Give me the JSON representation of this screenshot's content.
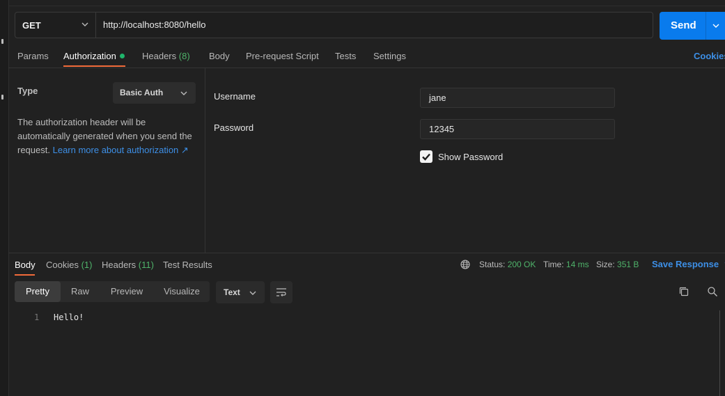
{
  "request": {
    "method": "GET",
    "url": "http://localhost:8080/hello",
    "send_label": "Send"
  },
  "request_tabs": [
    {
      "label": "Params"
    },
    {
      "label": "Authorization"
    },
    {
      "label": "Headers",
      "count": "(8)"
    },
    {
      "label": "Body"
    },
    {
      "label": "Pre-request Script"
    },
    {
      "label": "Tests"
    },
    {
      "label": "Settings"
    }
  ],
  "cookies_link": "Cookies",
  "auth": {
    "type_label": "Type",
    "type_value": "Basic Auth",
    "description": "The authorization header will be automatically generated when you send the request.",
    "learn_more": "Learn more about authorization ↗",
    "username_label": "Username",
    "username_value": "jane",
    "password_label": "Password",
    "password_value": "12345",
    "show_password_label": "Show Password",
    "show_password_checked": true
  },
  "response_tabs": [
    {
      "label": "Body"
    },
    {
      "label": "Cookies",
      "count": "(1)"
    },
    {
      "label": "Headers",
      "count": "(11)"
    },
    {
      "label": "Test Results"
    }
  ],
  "response_meta": {
    "status_label": "Status:",
    "status_value": "200 OK",
    "time_label": "Time:",
    "time_value": "14 ms",
    "size_label": "Size:",
    "size_value": "351 B",
    "save_label": "Save Response"
  },
  "view_modes": [
    "Pretty",
    "Raw",
    "Preview",
    "Visualize"
  ],
  "format": "Text",
  "body_lines": [
    {
      "no": "1",
      "text": "Hello!"
    }
  ],
  "colors": {
    "accent": "#097bed",
    "active_tab": "#f26b3a",
    "success": "#4fb36a",
    "link": "#3d8fe6"
  }
}
